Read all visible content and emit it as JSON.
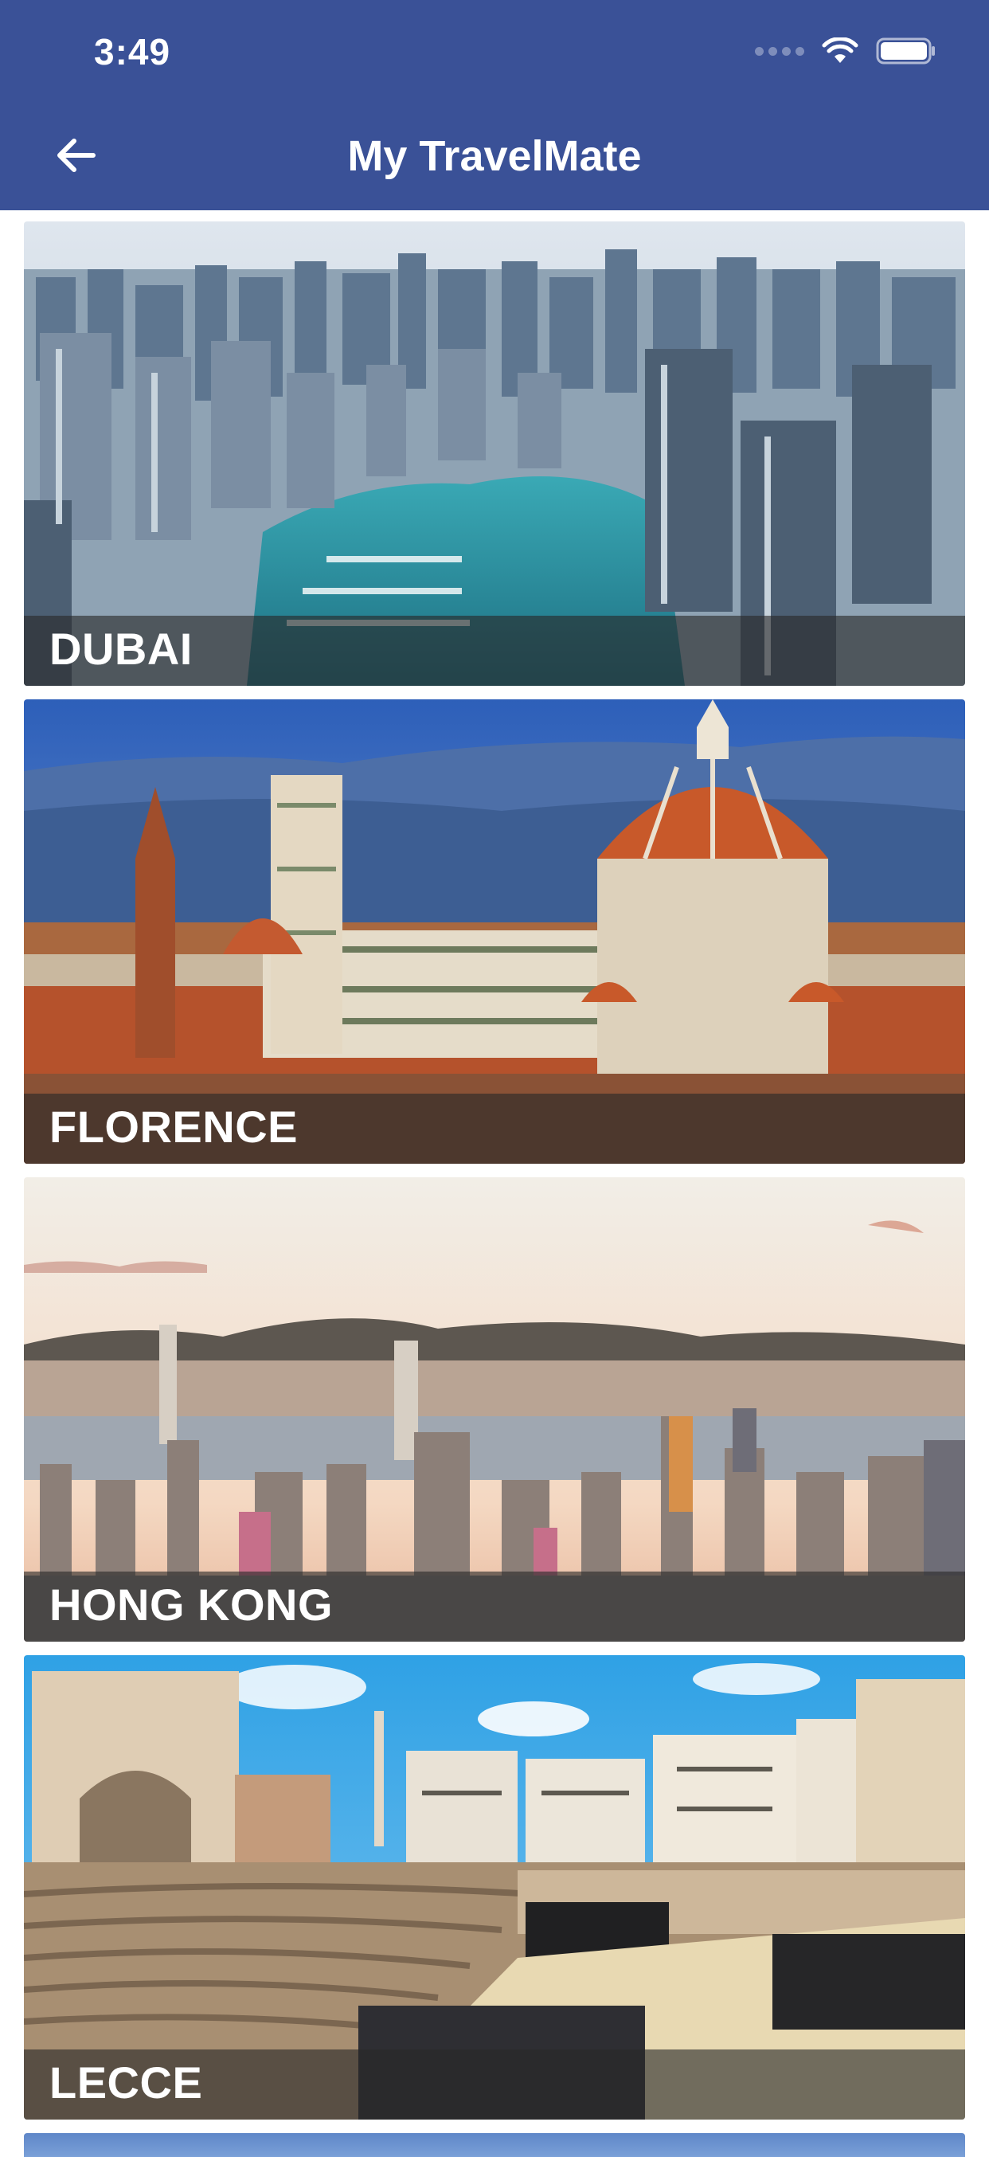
{
  "status_bar": {
    "time": "3:49"
  },
  "header": {
    "title": "My TravelMate",
    "back_icon": "arrow-left-icon",
    "background_color": "#3a5197"
  },
  "destinations": [
    {
      "name": "DUBAI"
    },
    {
      "name": "FLORENCE"
    },
    {
      "name": "HONG KONG"
    },
    {
      "name": "LECCE"
    }
  ]
}
